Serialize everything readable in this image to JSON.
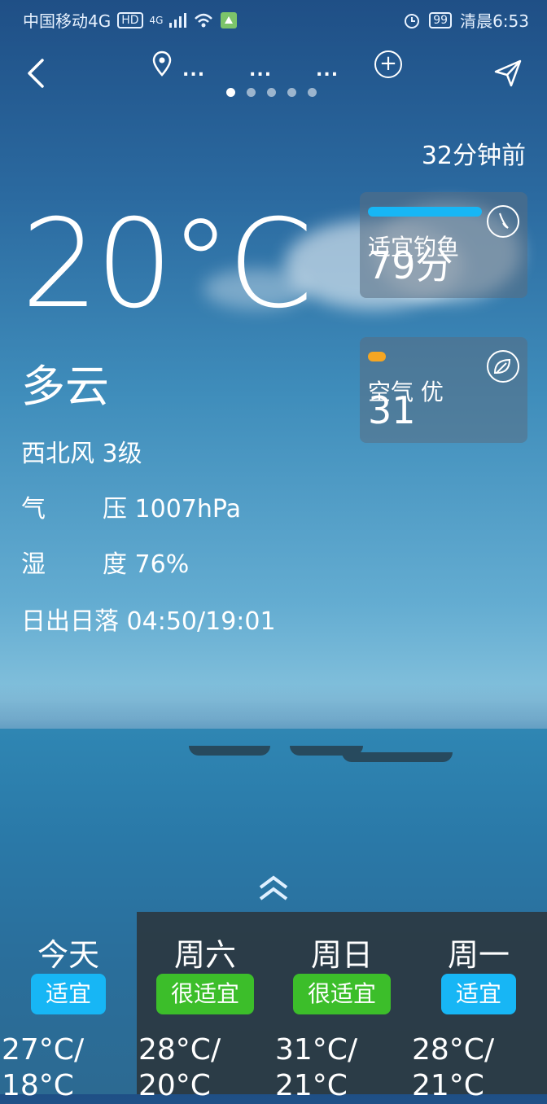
{
  "status_bar": {
    "carrier": "中国移动4G",
    "hd": "HD",
    "network": "4G",
    "battery": "99",
    "time": "清晨6:53"
  },
  "nav": {
    "cities": [
      "...",
      "...",
      "..."
    ],
    "page_dots": 5,
    "active_dot": 0
  },
  "weather": {
    "updated": "32分钟前",
    "temperature": "20°C",
    "condition": "多云",
    "wind": "西北风 3级",
    "pressure_label_a": "气",
    "pressure_label_b": "压",
    "pressure_value": "1007hPa",
    "humidity_label_a": "湿",
    "humidity_label_b": "度",
    "humidity_value": "76%",
    "sun_label": "日出日落",
    "sun_value": "04:50/19:01"
  },
  "cards": {
    "fishing": {
      "label": "适宜钓鱼",
      "value": "79分",
      "bar_color": "#17b6f5",
      "level": 0.75
    },
    "air": {
      "label": "空气 优",
      "value": "31",
      "bar_color": "#f5a623",
      "level": 0.12
    }
  },
  "forecast": [
    {
      "day": "今天",
      "status": "适宜",
      "status_color": "#17b6f5",
      "range": "27°C/\n18°C"
    },
    {
      "day": "周六",
      "status": "很适宜",
      "status_color": "#3cbe2a",
      "range": "28°C/\n20°C"
    },
    {
      "day": "周日",
      "status": "很适宜",
      "status_color": "#3cbe2a",
      "range": "31°C/\n21°C"
    },
    {
      "day": "周一",
      "status": "适宜",
      "status_color": "#17b6f5",
      "range": "28°C/\n21°C"
    }
  ]
}
